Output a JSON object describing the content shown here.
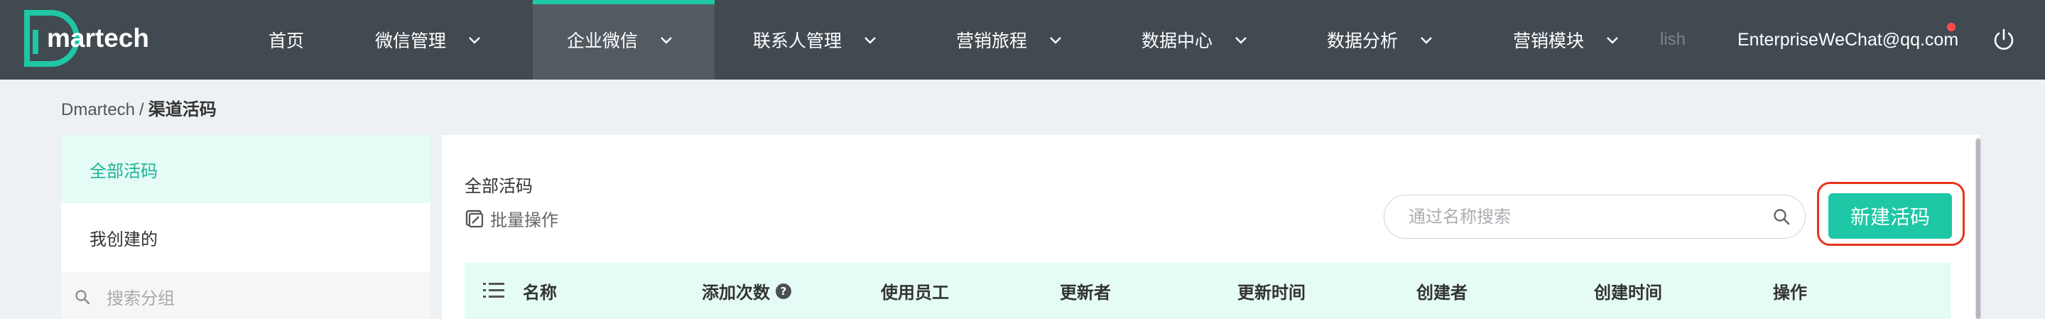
{
  "brand": {
    "logo_text": "martech",
    "accent": "#1ec7a5",
    "nav_bg": "#414a51"
  },
  "nav": {
    "items": [
      {
        "label": "首页"
      },
      {
        "label": "微信管理"
      },
      {
        "label": "企业微信"
      },
      {
        "label": "联系人管理"
      },
      {
        "label": "营销旅程"
      },
      {
        "label": "数据中心"
      },
      {
        "label": "数据分析"
      },
      {
        "label": "营销模块"
      }
    ],
    "overflow_label": "lish",
    "user_email": "EnterpriseWeChat@qq.com"
  },
  "breadcrumb": {
    "root": "Dmartech",
    "separator": "/",
    "current": "渠道活码"
  },
  "sidebar": {
    "groups": [
      {
        "label": "全部活码"
      },
      {
        "label": "我创建的"
      }
    ],
    "search_placeholder": "搜索分组"
  },
  "main": {
    "title": "全部活码",
    "batch_label": "批量操作",
    "search_placeholder": "通过名称搜索",
    "new_button_label": "新建活码"
  },
  "table": {
    "columns": [
      "名称",
      "添加次数",
      "使用员工",
      "更新者",
      "更新时间",
      "创建者",
      "创建时间",
      "操作"
    ],
    "help_glyph": "?"
  },
  "icons": [
    "logo-icon",
    "chevron-down-icon",
    "power-icon",
    "search-icon",
    "batch-edit-icon",
    "column-menu-icon",
    "help-icon"
  ]
}
